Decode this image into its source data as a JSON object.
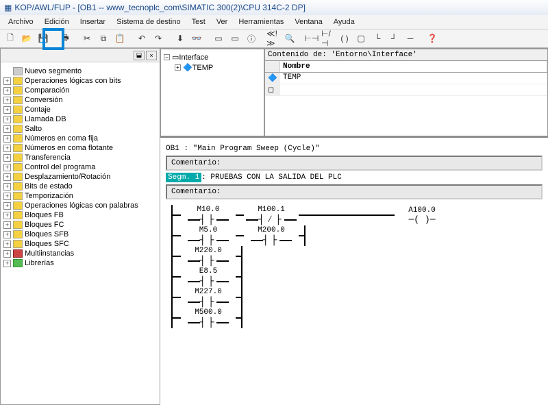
{
  "title": "KOP/AWL/FUP  - [OB1 -- www_tecnoplc_com\\SIMATIC 300(2)\\CPU 314C-2 DP]",
  "menu": [
    "Archivo",
    "Edición",
    "Insertar",
    "Sistema de destino",
    "Test",
    "Ver",
    "Herramientas",
    "Ventana",
    "Ayuda"
  ],
  "sidebar": {
    "items": [
      {
        "icon": "gray",
        "label": "Nuevo segmento"
      },
      {
        "icon": "yellow",
        "label": "Operaciones lógicas con bits"
      },
      {
        "icon": "yellow",
        "label": "Comparación"
      },
      {
        "icon": "yellow",
        "label": "Conversión"
      },
      {
        "icon": "yellow",
        "label": "Contaje"
      },
      {
        "icon": "yellow",
        "label": "Llamada DB"
      },
      {
        "icon": "yellow",
        "label": "Salto"
      },
      {
        "icon": "yellow",
        "label": "Números en coma fija"
      },
      {
        "icon": "yellow",
        "label": "Números en coma flotante"
      },
      {
        "icon": "yellow",
        "label": "Transferencia"
      },
      {
        "icon": "yellow",
        "label": "Control del programa"
      },
      {
        "icon": "yellow",
        "label": "Desplazamiento/Rotación"
      },
      {
        "icon": "yellow",
        "label": "Bits de estado"
      },
      {
        "icon": "yellow",
        "label": "Temporización"
      },
      {
        "icon": "yellow",
        "label": "Operaciones lógicas con palabras"
      },
      {
        "icon": "yellow",
        "label": "Bloques FB"
      },
      {
        "icon": "yellow",
        "label": "Bloques FC"
      },
      {
        "icon": "yellow",
        "label": "Bloques SFB"
      },
      {
        "icon": "yellow",
        "label": "Bloques SFC"
      },
      {
        "icon": "red",
        "label": "Multiinstancias"
      },
      {
        "icon": "green",
        "label": "Librerías"
      }
    ]
  },
  "interface": {
    "title": "Contenido de: 'Entorno\\Interface'",
    "col": "Nombre",
    "root": "Interface",
    "temp": "TEMP"
  },
  "editor": {
    "ob1": "OB1 :  \"Main Program Sweep (Cycle)\"",
    "comment": "Comentario:",
    "segm": "Segm. 1",
    "segm_title": ": PRUEBAS CON LA SALIDA DEL PLC",
    "contacts": {
      "m10": "M10.0",
      "m100": "M100.1",
      "a100": "A100.0",
      "m5": "M5.0",
      "m200": "M200.0",
      "m220": "M220.0",
      "e85": "E8.5",
      "m227": "M227.0",
      "m500": "M500.0"
    }
  }
}
